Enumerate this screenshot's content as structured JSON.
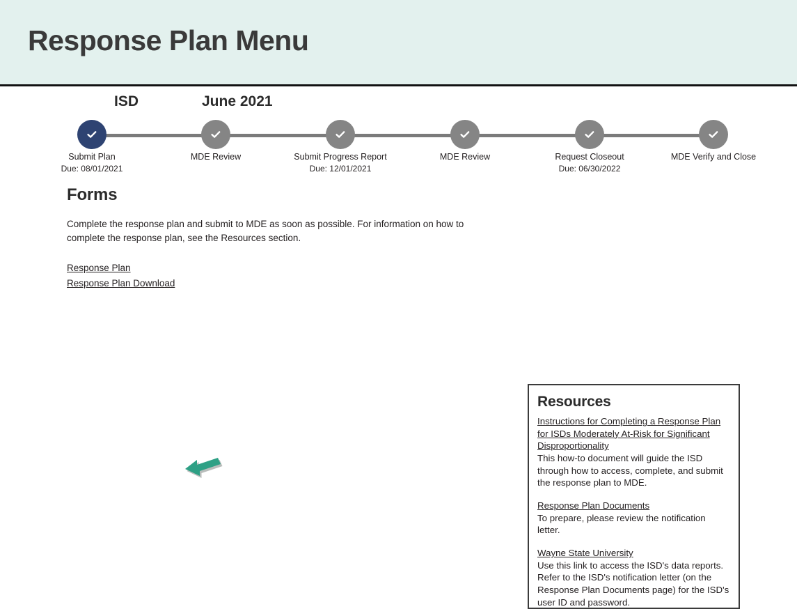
{
  "header": {
    "title": "Response Plan Menu",
    "background_color": "#E3F1EE",
    "title_color": "#3A3A3A",
    "rule_color": "#121212"
  },
  "stepper": {
    "org_label": "ISD",
    "period_label": "June 2021",
    "current_color": "#2E4372",
    "complete_color": "#858585",
    "track_color": "#7B7B7B",
    "check_icon": "check-icon",
    "steps": [
      {
        "label": "Submit Plan",
        "due": "Due: 08/01/2021",
        "state": "current"
      },
      {
        "label": "MDE Review",
        "due": "",
        "state": "complete"
      },
      {
        "label": "Submit Progress Report",
        "due": "Due: 12/01/2021",
        "state": "complete"
      },
      {
        "label": "MDE Review",
        "due": "",
        "state": "complete"
      },
      {
        "label": "Request Closeout",
        "due": "Due: 06/30/2022",
        "state": "complete"
      },
      {
        "label": "MDE Verify and Close",
        "due": "",
        "state": "complete"
      }
    ]
  },
  "forms": {
    "heading": "Forms",
    "intro": "Complete the response plan and submit to MDE as soon as possible. For information on how to complete the response plan, see the Resources section.",
    "links": [
      {
        "label": "Response Plan"
      },
      {
        "label": "Response Plan Download"
      }
    ]
  },
  "annotation": {
    "arrow": "left-arrow-annotation",
    "color": "#2EA085",
    "shadow_color": "#B9BDBB",
    "points_to": "Response Plan Download"
  },
  "resources": {
    "heading": "Resources",
    "items": [
      {
        "link": "Instructions for Completing a Response Plan for ISDs Moderately At-Risk for Significant Disproportionality",
        "description": "This how-to document will guide the ISD through how to access, complete, and submit the response plan to MDE."
      },
      {
        "link": "Response Plan Documents",
        "description": "To prepare, please review the notification letter."
      },
      {
        "link": "Wayne State University",
        "description": "Use this link to access the ISD's data reports. Refer to the ISD's notification letter (on the Response Plan Documents page) for the ISD's user ID and password."
      }
    ]
  }
}
